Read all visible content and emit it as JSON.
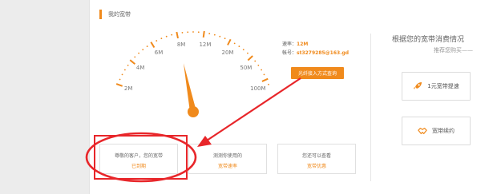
{
  "page": {
    "title": "我的宽带"
  },
  "gauge": {
    "labels": [
      "2M",
      "4M",
      "6M",
      "8M",
      "12M",
      "20M",
      "50M",
      "100M"
    ],
    "needle_value_fraction": 0.42
  },
  "account": {
    "rate_label": "速率：",
    "rate_value": "12M",
    "account_label": "帐号：",
    "account_value": "st3279285@163.gd"
  },
  "query_button": "光纤接入方式查询",
  "cards": [
    {
      "line1": "尊敬的客户，您的宽带",
      "line2": "已到期"
    },
    {
      "line1": "测测你使用的",
      "line2": "宽带速率"
    },
    {
      "line1": "您还可以查看",
      "line2": "宽带优惠"
    }
  ],
  "right_panel": {
    "title": "根据您的宽带消费情况",
    "subtitle": "推荐您购买——",
    "buttons": [
      {
        "label": "1元宽带提速",
        "icon": "rocket-icon"
      },
      {
        "label": "宽带续约",
        "icon": "handshake-icon"
      }
    ]
  },
  "colors": {
    "accent": "#f08a1c",
    "highlight": "#e8262a"
  }
}
